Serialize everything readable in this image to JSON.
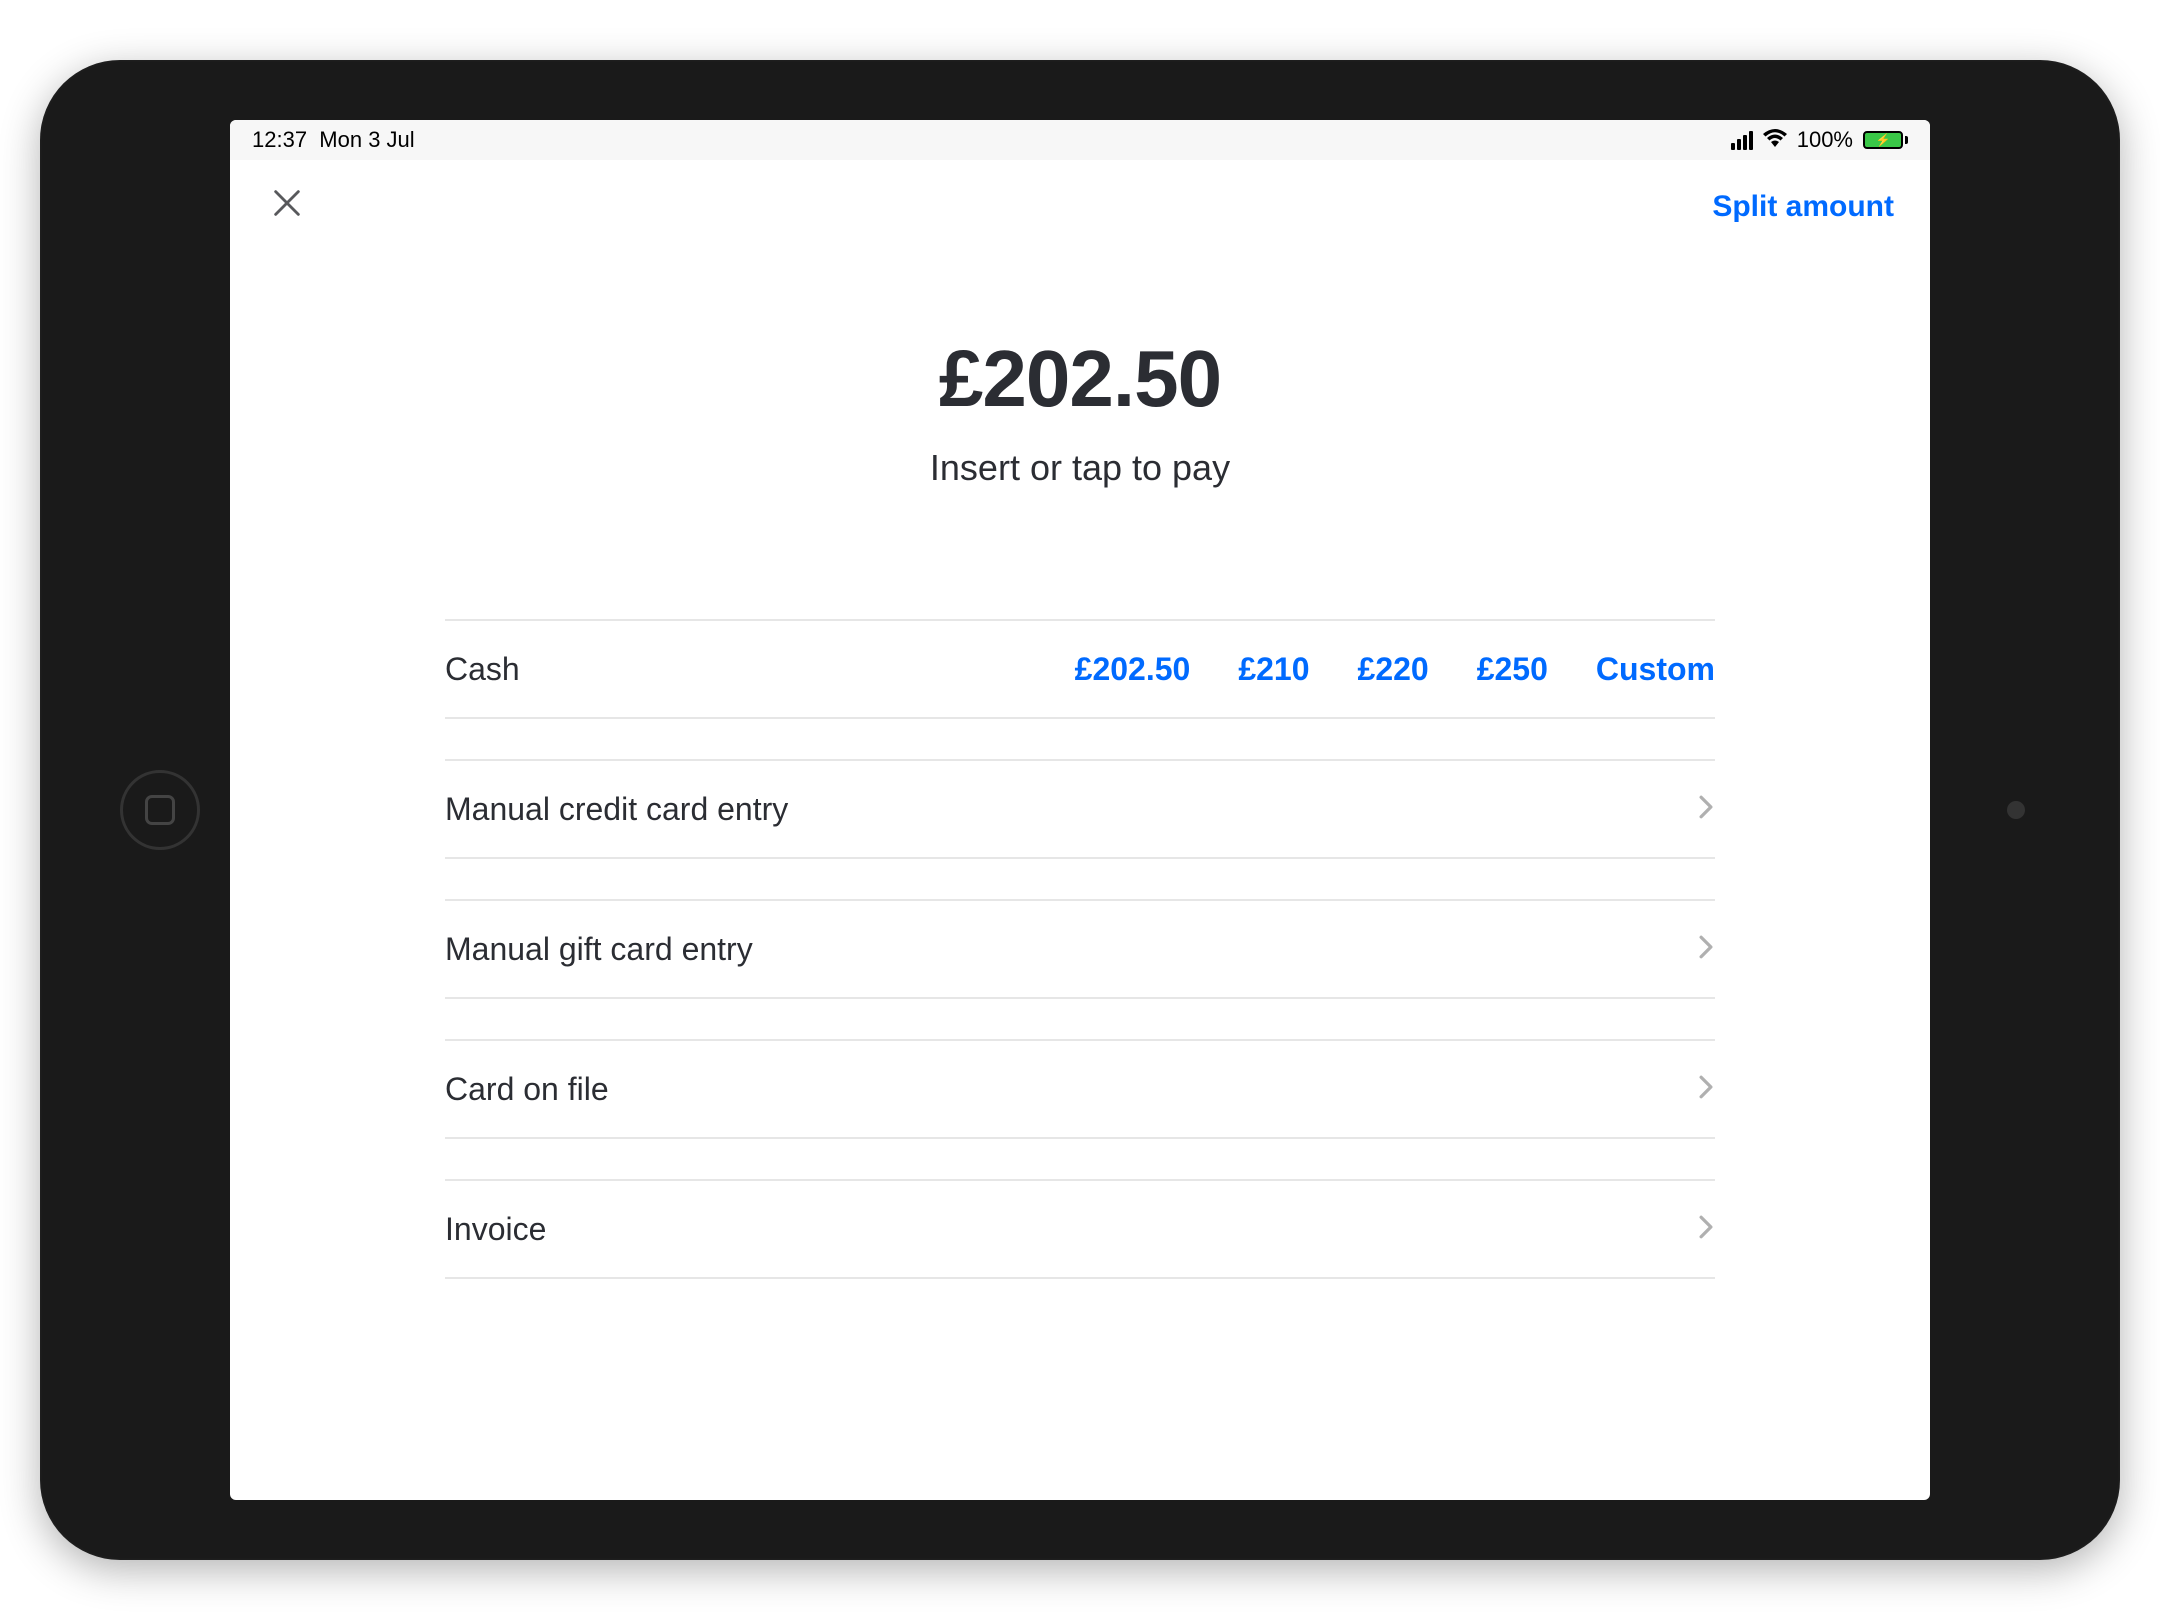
{
  "status": {
    "time": "12:37",
    "date": "Mon 3 Jul",
    "battery": "100%"
  },
  "nav": {
    "split_label": "Split amount"
  },
  "payment": {
    "amount": "£202.50",
    "instruction": "Insert or tap to pay",
    "cash_label": "Cash",
    "cash_options": {
      "exact": "£202.50",
      "o1": "£210",
      "o2": "£220",
      "o3": "£250",
      "custom": "Custom"
    },
    "methods": {
      "manual_cc": "Manual credit card entry",
      "manual_gift": "Manual gift card entry",
      "card_on_file": "Card on file",
      "invoice": "Invoice"
    }
  },
  "colors": {
    "accent": "#006aff",
    "text_primary": "#2b2d33"
  }
}
